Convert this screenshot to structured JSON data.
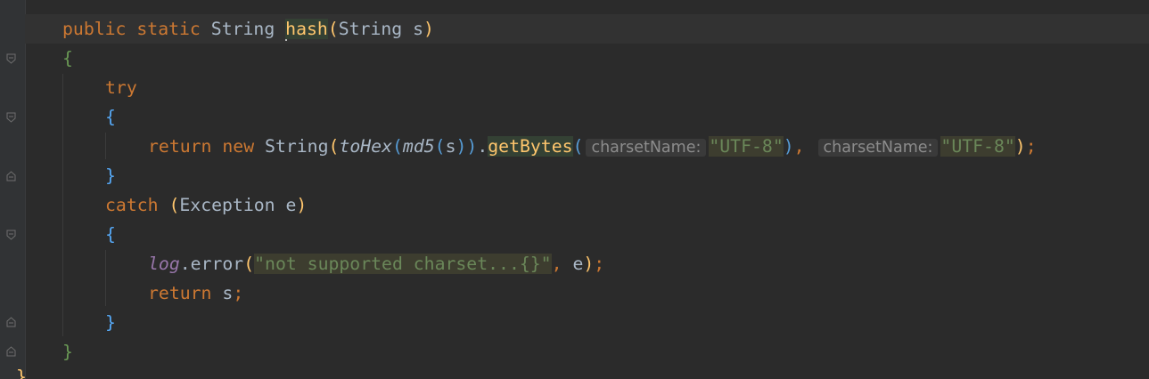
{
  "editor": {
    "line1": {
      "kw_public": "public",
      "kw_static": "static",
      "type_string": "String",
      "method_name": "hash",
      "paren_open": "(",
      "param_type": "String",
      "param_name": "s",
      "paren_close": ")"
    },
    "line2": {
      "brace": "{"
    },
    "line3": {
      "kw_try": "try"
    },
    "line4": {
      "brace": "{"
    },
    "line5": {
      "kw_return": "return",
      "kw_new": "new",
      "ctor": "String",
      "p1": "(",
      "fn_tohex": "toHex",
      "p2": "(",
      "fn_md5": "md5",
      "p3": "(",
      "arg_s": "s",
      "p3c": ")",
      "p2c": ")",
      "dot": ".",
      "method_getbytes": "getBytes",
      "p4": "(",
      "hint1": "charsetName:",
      "str1": "\"UTF-8\"",
      "p4c": ")",
      "comma": ",",
      "hint2": "charsetName:",
      "str2": "\"UTF-8\"",
      "p1c": ")",
      "semi": ";"
    },
    "line6": {
      "brace": "}"
    },
    "line7": {
      "kw_catch": "catch",
      "p_open": "(",
      "exc_type": "Exception",
      "exc_var": "e",
      "p_close": ")"
    },
    "line8": {
      "brace": "{"
    },
    "line9": {
      "field_log": "log",
      "dot": ".",
      "method_error": "error",
      "p_open": "(",
      "str_msg": "\"not supported charset...{}\"",
      "comma": ",",
      "arg_e": "e",
      "p_close": ")",
      "semi": ";"
    },
    "line10": {
      "kw_return": "return",
      "ret_var": "s",
      "semi": ";"
    },
    "line11": {
      "brace": "}"
    },
    "line12": {
      "brace": "}"
    },
    "line13": {
      "brace": "}"
    }
  }
}
